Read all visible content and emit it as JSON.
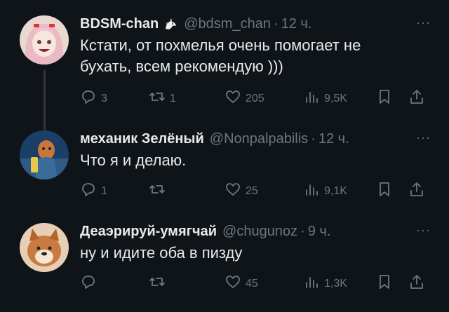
{
  "tweets": [
    {
      "name": "BDSM-chan",
      "badge": "unicorn-emoji",
      "handle": "@bdsm_chan",
      "dot": "·",
      "time": "12 ч.",
      "more": "···",
      "text": "Кстати, от похмелья очень помогает не\nбухать, всем рекомендую )))",
      "replies": "3",
      "retweets": "1",
      "likes": "205",
      "views": "9,5K"
    },
    {
      "name": "механик Зелёный",
      "handle": "@Nonpalpabilis",
      "dot": "·",
      "time": "12 ч.",
      "more": "···",
      "text": "Что я и делаю.",
      "replies": "1",
      "retweets": "",
      "likes": "25",
      "views": "9,1K"
    },
    {
      "name": "Деаэрируй-умягчай",
      "handle": "@chugunoz",
      "dot": "·",
      "time": "9 ч.",
      "more": "···",
      "text": "ну и идите оба в пизду",
      "replies": "",
      "retweets": "",
      "likes": "45",
      "views": "1,3K"
    }
  ],
  "colors": {
    "background": "#0f1419",
    "text": "#e7e9ea",
    "muted": "#71767b",
    "thread_line": "#333639"
  }
}
